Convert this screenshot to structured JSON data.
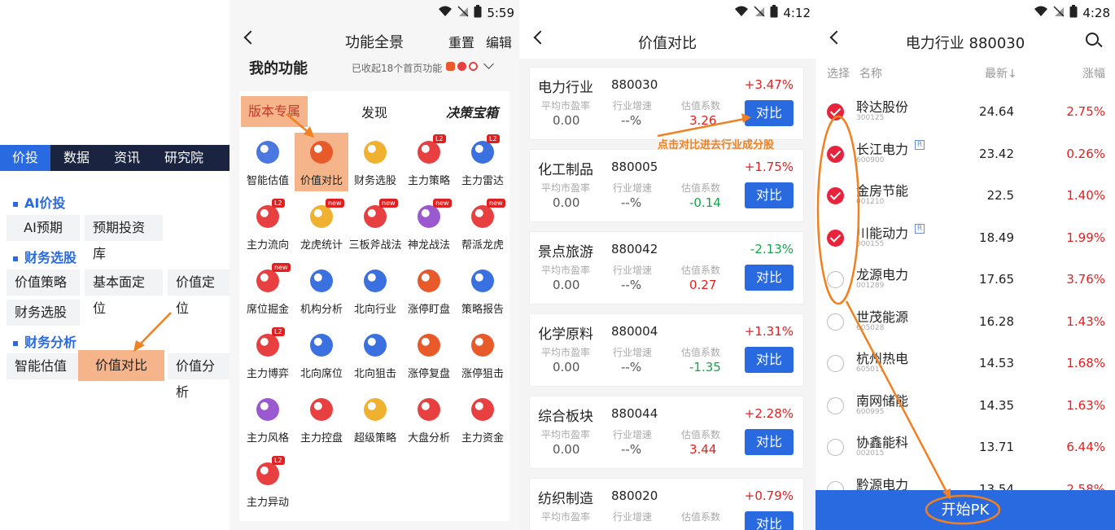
{
  "panel1": {
    "tabs": [
      "价投",
      "数据",
      "资讯",
      "研究院"
    ],
    "section_ai": "AI价投",
    "section_fin_select": "财务选股",
    "section_fin_analysis": "财务分析",
    "chips": [
      "AI预期",
      "预期投资库",
      "价值策略",
      "基本面定位",
      "价值定位",
      "财务选股",
      "智能估值",
      "价值对比",
      "价值分析"
    ]
  },
  "panel2": {
    "time": "5:59",
    "title": "功能全景",
    "reset": "重置",
    "edit": "编辑",
    "my_functions": "我的功能",
    "collected": "已收起18个首页功能",
    "tabs": [
      "版本专属",
      "发现",
      "决策宝箱"
    ],
    "items": [
      {
        "label": "智能估值",
        "badge": "",
        "color": "#4a78e0"
      },
      {
        "label": "价值对比",
        "badge": "",
        "color": "#e85a2a"
      },
      {
        "label": "财务选股",
        "badge": "",
        "color": "#f0b030"
      },
      {
        "label": "主力策略",
        "badge": "L2",
        "color": "#e84040"
      },
      {
        "label": "主力雷达",
        "badge": "L2",
        "color": "#3a70e0"
      },
      {
        "label": "主力流向",
        "badge": "L2",
        "color": "#e84040"
      },
      {
        "label": "龙虎统计",
        "badge": "new",
        "color": "#f0b030"
      },
      {
        "label": "三板斧战法",
        "badge": "new",
        "color": "#e84040"
      },
      {
        "label": "神龙战法",
        "badge": "new",
        "color": "#9b59d0"
      },
      {
        "label": "帮派龙虎",
        "badge": "new",
        "color": "#e84040"
      },
      {
        "label": "席位掘金",
        "badge": "new",
        "color": "#e84040"
      },
      {
        "label": "机构分析",
        "badge": "",
        "color": "#3a70e0"
      },
      {
        "label": "北向行业",
        "badge": "",
        "color": "#3a70e0"
      },
      {
        "label": "涨停盯盘",
        "badge": "",
        "color": "#e85a2a"
      },
      {
        "label": "策略报告",
        "badge": "",
        "color": "#3a70e0"
      },
      {
        "label": "主力博弈",
        "badge": "L2",
        "color": "#e84040"
      },
      {
        "label": "北向席位",
        "badge": "",
        "color": "#3a70e0"
      },
      {
        "label": "北向狙击",
        "badge": "",
        "color": "#3a70e0"
      },
      {
        "label": "涨停复盘",
        "badge": "",
        "color": "#e85a2a"
      },
      {
        "label": "涨停狙击",
        "badge": "",
        "color": "#e85a2a"
      },
      {
        "label": "主力风格",
        "badge": "",
        "color": "#9b59d0"
      },
      {
        "label": "主力控盘",
        "badge": "",
        "color": "#e84040"
      },
      {
        "label": "超级策略",
        "badge": "",
        "color": "#f0b030"
      },
      {
        "label": "大盘分析",
        "badge": "",
        "color": "#e84040"
      },
      {
        "label": "主力资金",
        "badge": "",
        "color": "#e84040"
      },
      {
        "label": "主力异动",
        "badge": "L2",
        "color": "#e84040"
      }
    ]
  },
  "panel3": {
    "time": "4:12",
    "title": "价值对比",
    "h1": "平均市盈率",
    "h2": "行业增速",
    "h3": "估值系数",
    "btn": "对比",
    "annotation": "点击对比进去行业成分股",
    "cards": [
      {
        "name": "电力行业",
        "code": "880030",
        "pct": "+3.47%",
        "pe": "0.00",
        "growth": "--%",
        "coef": "3.26",
        "up": true,
        "coef_up": true
      },
      {
        "name": "化工制品",
        "code": "880005",
        "pct": "+1.75%",
        "pe": "0.00",
        "growth": "--%",
        "coef": "-0.14",
        "up": true,
        "coef_up": false
      },
      {
        "name": "景点旅游",
        "code": "880042",
        "pct": "-2.13%",
        "pe": "0.00",
        "growth": "--%",
        "coef": "0.27",
        "up": false,
        "coef_up": true
      },
      {
        "name": "化学原料",
        "code": "880004",
        "pct": "+1.31%",
        "pe": "0.00",
        "growth": "--%",
        "coef": "-1.35",
        "up": true,
        "coef_up": false
      },
      {
        "name": "综合板块",
        "code": "880044",
        "pct": "+2.28%",
        "pe": "0.00",
        "growth": "--%",
        "coef": "3.44",
        "up": true,
        "coef_up": true
      },
      {
        "name": "纺织制造",
        "code": "880020",
        "pct": "+0.79%",
        "pe": "",
        "growth": "",
        "coef": "",
        "up": true,
        "coef_up": true
      }
    ]
  },
  "panel4": {
    "time": "4:28",
    "title": "电力行业 880030",
    "h_select": "选择",
    "h_name": "名称",
    "h_price": "最新↓",
    "h_change": "涨幅",
    "pk": "开始PK",
    "rows": [
      {
        "name": "聆达股份",
        "code": "300125",
        "price": "24.64",
        "change": "2.75%",
        "checked": true,
        "r": false
      },
      {
        "name": "长江电力",
        "code": "600900",
        "price": "23.42",
        "change": "0.26%",
        "checked": true,
        "r": true
      },
      {
        "name": "金房节能",
        "code": "001210",
        "price": "22.5",
        "change": "1.40%",
        "checked": true,
        "r": false
      },
      {
        "name": "川能动力",
        "code": "000155",
        "price": "18.49",
        "change": "1.99%",
        "checked": true,
        "r": true
      },
      {
        "name": "龙源电力",
        "code": "001289",
        "price": "17.65",
        "change": "3.76%",
        "checked": false,
        "r": false
      },
      {
        "name": "世茂能源",
        "code": "605028",
        "price": "16.28",
        "change": "1.43%",
        "checked": false,
        "r": false
      },
      {
        "name": "杭州热电",
        "code": "605011",
        "price": "14.53",
        "change": "1.68%",
        "checked": false,
        "r": false
      },
      {
        "name": "南网储能",
        "code": "600995",
        "price": "14.35",
        "change": "1.63%",
        "checked": false,
        "r": false
      },
      {
        "name": "协鑫能科",
        "code": "002015",
        "price": "13.71",
        "change": "6.44%",
        "checked": false,
        "r": false
      },
      {
        "name": "黔源电力",
        "code": "",
        "price": "13.54",
        "change": "2.58%",
        "checked": false,
        "r": false
      }
    ],
    "r_badge": "R"
  }
}
